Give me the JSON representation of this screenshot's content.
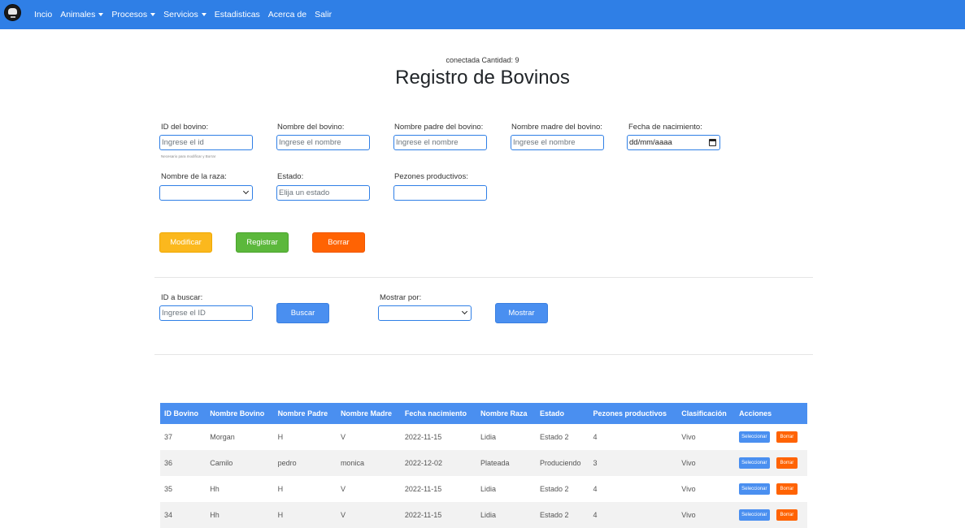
{
  "nav": {
    "items": [
      {
        "label": "Incio",
        "dropdown": false
      },
      {
        "label": "Animales",
        "dropdown": true
      },
      {
        "label": "Procesos",
        "dropdown": true
      },
      {
        "label": "Servicios",
        "dropdown": true
      },
      {
        "label": "Estadisticas",
        "dropdown": false
      },
      {
        "label": "Acerca de",
        "dropdown": false
      },
      {
        "label": "Salir",
        "dropdown": false
      }
    ]
  },
  "header": {
    "status": "conectada Cantidad: 9",
    "title": "Registro de Bovinos"
  },
  "form": {
    "id_label": "ID del bovino:",
    "id_placeholder": "Ingrese el id",
    "id_hint": "Necesario para modificar y Borrar",
    "nombre_label": "Nombre del bovino:",
    "nombre_placeholder": "Ingrese el nombre",
    "padre_label": "Nombre padre del bovino:",
    "padre_placeholder": "Ingrese el nombre",
    "madre_label": "Nombre madre del bovino:",
    "madre_placeholder": "Ingrese el nombre",
    "fecha_label": "Fecha de nacimiento:",
    "fecha_value": "dd/mm/aaaa",
    "raza_label": "Nombre de la raza:",
    "raza_value": "",
    "estado_label": "Estado:",
    "estado_placeholder": "Elija un estado",
    "pezones_label": "Pezones productivos:",
    "pezones_value": ""
  },
  "actions": {
    "modificar": "Modificar",
    "registrar": "Registrar",
    "borrar": "Borrar"
  },
  "search": {
    "id_label": "ID a buscar:",
    "id_placeholder": "Ingrese el ID",
    "buscar": "Buscar",
    "mostrar_label": "Mostrar por:",
    "mostrar_value": "",
    "mostrar": "Mostrar"
  },
  "table": {
    "headers": [
      "ID Bovino",
      "Nombre Bovino",
      "Nombre Padre",
      "Nombre Madre",
      "Fecha nacimiento",
      "Nombre Raza",
      "Estado",
      "Pezones productivos",
      "Clasificación",
      "Acciones"
    ],
    "select_label": "Seleccionar",
    "delete_label": "Borrar",
    "rows": [
      [
        "37",
        "Morgan",
        "H",
        "V",
        "2022-11-15",
        "Lidia",
        "Estado 2",
        "4",
        "Vivo"
      ],
      [
        "36",
        "Camilo",
        "pedro",
        "monica",
        "2022-12-02",
        "Plateada",
        "Produciendo",
        "3",
        "Vivo"
      ],
      [
        "35",
        "Hh",
        "H",
        "V",
        "2022-11-15",
        "Lidia",
        "Estado 2",
        "4",
        "Vivo"
      ],
      [
        "34",
        "Hh",
        "H",
        "V",
        "2022-11-15",
        "Lidia",
        "Estado 2",
        "4",
        "Vivo"
      ]
    ]
  },
  "colors": {
    "navbar": "#2f7fe6",
    "primary": "#4a8ff0",
    "warning": "#fbb81d",
    "success": "#5cb83c",
    "danger": "#ff6303"
  }
}
